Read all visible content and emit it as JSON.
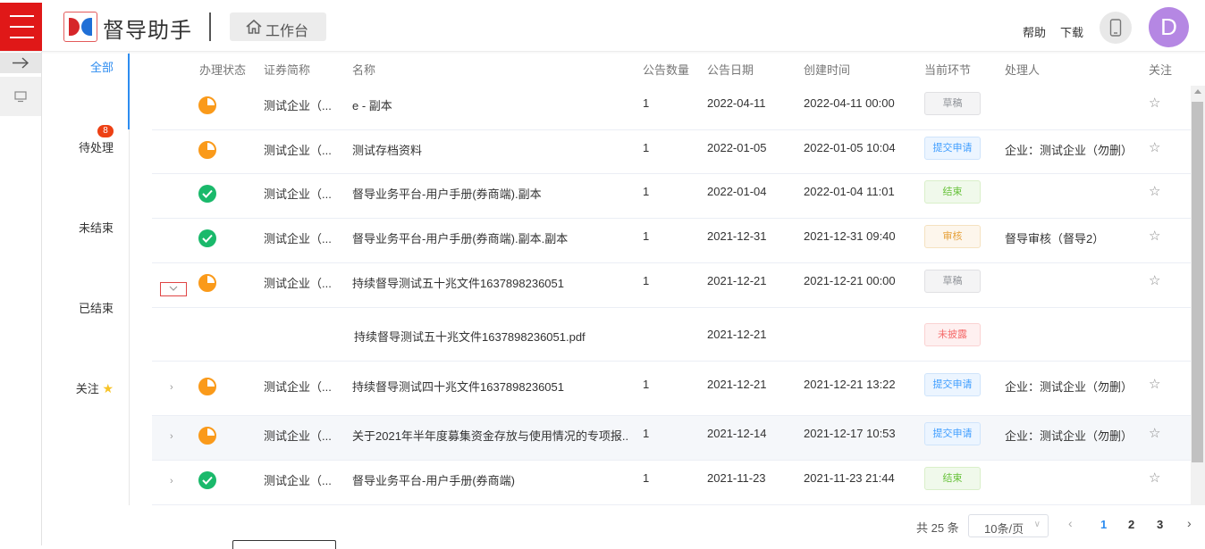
{
  "header": {
    "app_title": "督导助手",
    "workbench_label": "工作台",
    "help_label": "帮助",
    "download_label": "下载",
    "avatar_letter": "D",
    "avatar_color": "#b587e3",
    "brand_red": "#e01818"
  },
  "categories": {
    "all": "全部",
    "pending": "待处理",
    "pending_count": "8",
    "unfinished": "未结束",
    "finished": "已结束",
    "follow": "关注"
  },
  "table": {
    "columns": [
      "办理状态",
      "证券简称",
      "名称",
      "公告数量",
      "公告日期",
      "创建时间",
      "当前环节",
      "处理人",
      "关注"
    ],
    "rows": [
      {
        "status": "in-progress",
        "security": "测试企业（...",
        "name": "e - 副本",
        "count": "1",
        "date": "2022-04-11",
        "created": "2022-04-11 00:00",
        "stage": "草稿",
        "stage_type": "draft",
        "handler": ""
      },
      {
        "status": "in-progress",
        "security": "测试企业（...",
        "name": "测试存档资料",
        "count": "1",
        "date": "2022-01-05",
        "created": "2022-01-05 10:04",
        "stage": "提交申请",
        "stage_type": "submit",
        "handler": "企业：测试企业（勿删）"
      },
      {
        "status": "done",
        "security": "测试企业（...",
        "name": "督导业务平台-用户手册(券商端).副本",
        "count": "1",
        "date": "2022-01-04",
        "created": "2022-01-04 11:01",
        "stage": "结束",
        "stage_type": "done",
        "handler": ""
      },
      {
        "status": "done",
        "security": "测试企业（...",
        "name": "督导业务平台-用户手册(券商端).副本.副本",
        "count": "1",
        "date": "2021-12-31",
        "created": "2021-12-31 09:40",
        "stage": "审核",
        "stage_type": "review",
        "handler": "督导审核（督导2）"
      },
      {
        "status": "in-progress",
        "security": "测试企业（...",
        "name": "持续督导测试五十兆文件1637898236051",
        "count": "1",
        "date": "2021-12-21",
        "created": "2021-12-21 00:00",
        "stage": "草稿",
        "stage_type": "draft",
        "handler": ""
      },
      {
        "sub": true,
        "name": "持续督导测试五十兆文件1637898236051.pdf",
        "date": "2021-12-21",
        "stage": "未披露",
        "stage_type": "undisclosed"
      },
      {
        "status": "in-progress",
        "security": "测试企业（...",
        "name": "持续督导测试四十兆文件1637898236051",
        "count": "1",
        "date": "2021-12-21",
        "created": "2021-12-21 13:22",
        "stage": "提交申请",
        "stage_type": "submit",
        "handler": "企业：测试企业（勿删）"
      },
      {
        "status": "in-progress",
        "security": "测试企业（...",
        "name": "关于2021年半年度募集资金存放与使用情况的专项报...",
        "count": "1",
        "date": "2021-12-14",
        "created": "2021-12-17 10:53",
        "stage": "提交申请",
        "stage_type": "submit",
        "handler": "企业：测试企业（勿删）"
      },
      {
        "status": "done",
        "security": "测试企业（...",
        "name": "督导业务平台-用户手册(券商端)",
        "count": "1",
        "date": "2021-11-23",
        "created": "2021-11-23 21:44",
        "stage": "结束",
        "stage_type": "done",
        "handler": ""
      }
    ]
  },
  "pagination": {
    "total": "共 25 条",
    "page_size": "10条/页",
    "pages": [
      "1",
      "2",
      "3"
    ],
    "current": "1"
  }
}
